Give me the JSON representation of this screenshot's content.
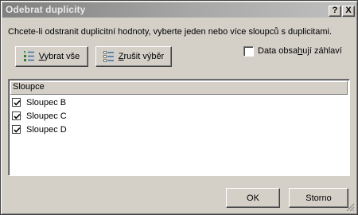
{
  "dialog": {
    "title": "Odebrat duplicity",
    "help_glyph": "?",
    "close_glyph": "X"
  },
  "instruction": "Chcete-li odstranit duplicitní hodnoty, vyberte jeden nebo více sloupců s duplicitami.",
  "buttons": {
    "select_all": {
      "mnemonic": "V",
      "rest": "ybrat vše"
    },
    "unselect_all": {
      "mnemonic": "Z",
      "rest": "rušit výběr"
    },
    "ok": "OK",
    "cancel": "Storno"
  },
  "headers_option": {
    "before": "Data obsa",
    "mnemonic": "h",
    "after": "ují záhlaví",
    "checked": false
  },
  "columns_list": {
    "header": "Sloupce",
    "items": [
      {
        "label": "Sloupec B",
        "checked": true
      },
      {
        "label": "Sloupec C",
        "checked": true
      },
      {
        "label": "Sloupec D",
        "checked": true
      }
    ]
  },
  "icons": {
    "select_all": "select-all-list-icon",
    "unselect_all": "unselect-all-list-icon"
  }
}
